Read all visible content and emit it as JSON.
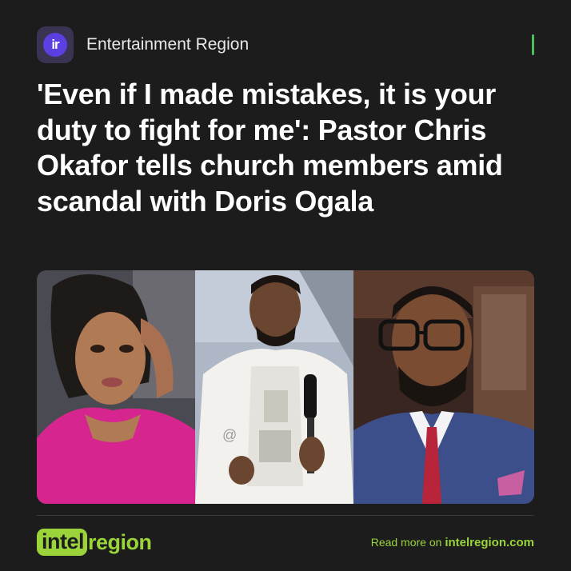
{
  "header": {
    "logo_text": "ir",
    "source_name": "Entertainment Region"
  },
  "headline": "'Even if I made mistakes, it is your duty to fight for me': Pastor Chris Okafor tells church members amid scandal with Doris Ogala",
  "image": {
    "watermark": "@"
  },
  "footer": {
    "brand_highlight": "intel",
    "brand_rest": "region",
    "read_more_prefix": "Read more on ",
    "read_more_site": "intelregion.com"
  },
  "colors": {
    "background": "#1c1c1c",
    "accent_green": "#9ad43a",
    "bar_green": "#47c05e",
    "logo_purple": "#5b3fe0"
  }
}
